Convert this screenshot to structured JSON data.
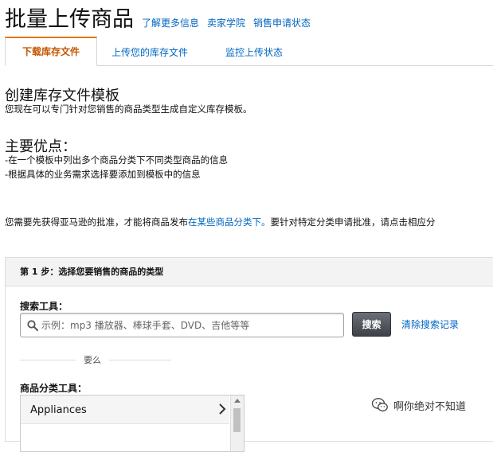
{
  "header": {
    "title": "批量上传商品",
    "links": [
      "了解更多信息",
      "卖家学院",
      "销售申请状态"
    ]
  },
  "tabs": [
    {
      "label": "下载库存文件",
      "active": true
    },
    {
      "label": "上传您的库存文件",
      "active": false
    },
    {
      "label": "监控上传状态",
      "active": false
    }
  ],
  "template_section": {
    "title": "创建库存文件模板",
    "description": "您现在可以专门针对您销售的商品类型生成自定义库存模板。"
  },
  "advantages": {
    "title": "主要优点：",
    "items": [
      "-在一个模板中列出多个商品分类下不同类型商品的信息",
      "-根据具体的业务需求选择要添加到模板中的信息"
    ]
  },
  "approval_notice": {
    "prefix": "您需要先获得亚马逊的批准，才能将商品发布",
    "link": "在某些商品分类下。",
    "suffix": "要针对特定分类申请批准，请点击相应分"
  },
  "step1": {
    "heading": "第 1 步：选择您要销售的商品的类型",
    "search_label": "搜索工具：",
    "search_placeholder": "示例：mp3 播放器、棒球手套、DVD、吉他等等",
    "search_button": "搜索",
    "clear_link": "清除搜索记录",
    "or_text": "要么",
    "category_label": "商品分类工具：",
    "categories": [
      "Appliances"
    ]
  },
  "watermark": {
    "text": "啊你绝对不知道",
    "icon": "wechat-icon"
  },
  "colors": {
    "link": "#0066c0",
    "active_tab": "#c45500",
    "tab_accent": "#e77600",
    "search_button": "#4a4e54"
  }
}
